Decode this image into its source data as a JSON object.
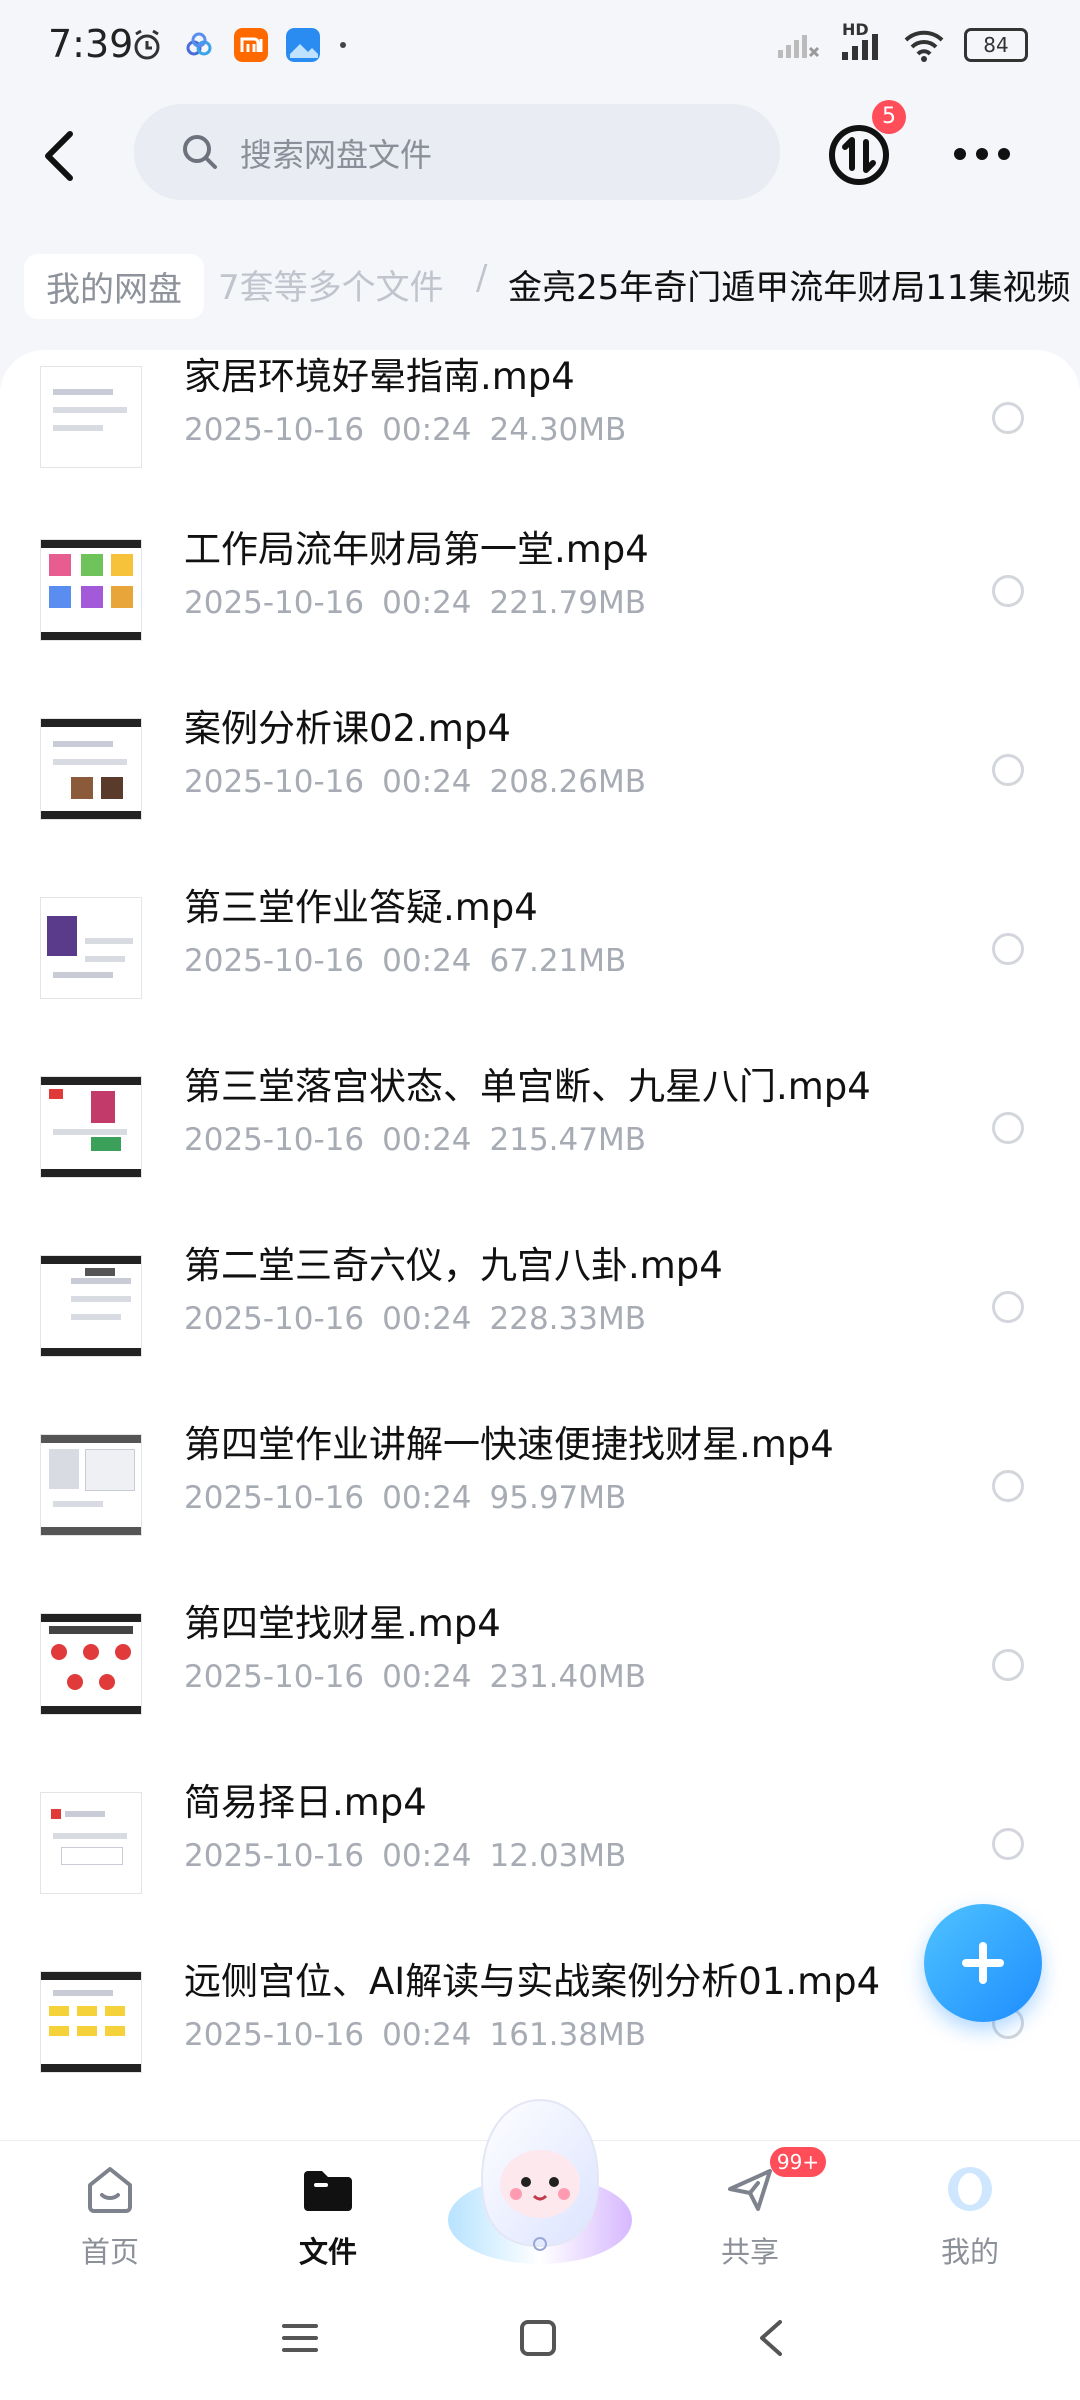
{
  "status_bar": {
    "time": "7:39",
    "network": "HD",
    "battery": "84"
  },
  "header": {
    "search_placeholder": "搜索网盘文件",
    "transfer_badge": "5"
  },
  "breadcrumb": {
    "root": "我的网盘",
    "middle": "7套等多个文件",
    "separator": "/",
    "current": "金亮25年奇门遁甲流年财局11集视频"
  },
  "files": [
    {
      "name": "家居环境好晕指南.mp4",
      "date": "2025-10-16",
      "time": "00:24",
      "size": "24.30MB"
    },
    {
      "name": "工作局流年财局第一堂.mp4",
      "date": "2025-10-16",
      "time": "00:24",
      "size": "221.79MB"
    },
    {
      "name": "案例分析课02.mp4",
      "date": "2025-10-16",
      "time": "00:24",
      "size": "208.26MB"
    },
    {
      "name": "第三堂作业答疑.mp4",
      "date": "2025-10-16",
      "time": "00:24",
      "size": "67.21MB"
    },
    {
      "name": "第三堂落宫状态、单宫断、九星八门.mp4",
      "date": "2025-10-16",
      "time": "00:24",
      "size": "215.47MB"
    },
    {
      "name": "第二堂三奇六仪，九宫八卦.mp4",
      "date": "2025-10-16",
      "time": "00:24",
      "size": "228.33MB"
    },
    {
      "name": "第四堂作业讲解一快速便捷找财星.mp4",
      "date": "2025-10-16",
      "time": "00:24",
      "size": "95.97MB"
    },
    {
      "name": "第四堂找财星.mp4",
      "date": "2025-10-16",
      "time": "00:24",
      "size": "231.40MB"
    },
    {
      "name": "简易择日.mp4",
      "date": "2025-10-16",
      "time": "00:24",
      "size": "12.03MB"
    },
    {
      "name": "远侧宫位、AI解读与实战案例分析01.mp4",
      "date": "2025-10-16",
      "time": "00:24",
      "size": "161.38MB"
    }
  ],
  "bottom_nav": {
    "home": "首页",
    "files": "文件",
    "share": "共享",
    "share_badge": "99+",
    "mine": "我的"
  },
  "colors": {
    "accent": "#1e8dff",
    "badge": "#ff4d5a",
    "meta_text": "#a7abb3"
  }
}
